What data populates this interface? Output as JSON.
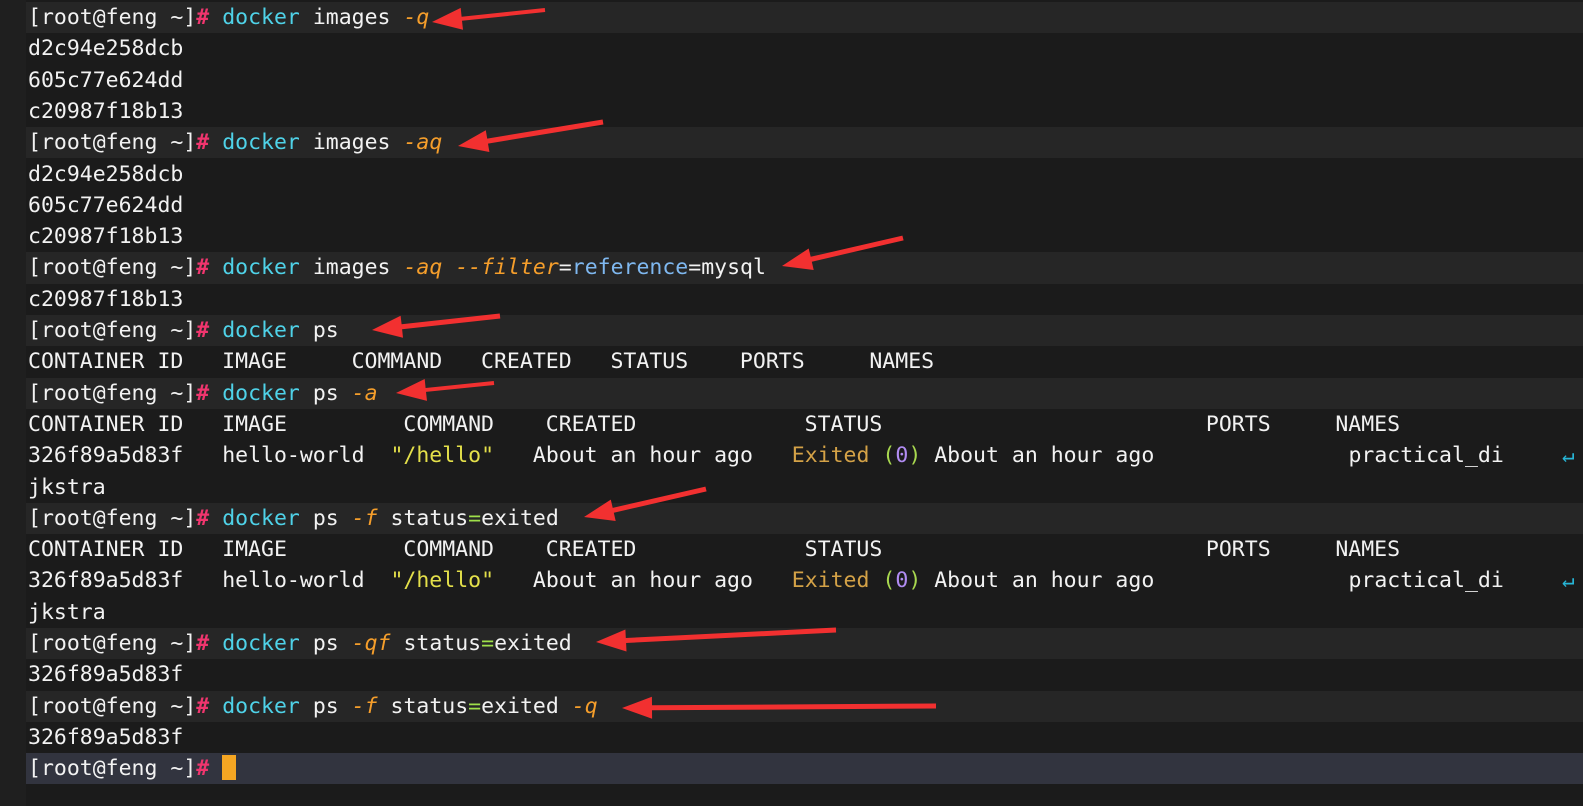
{
  "terminal": {
    "prompt": "[root@feng ~]#",
    "prompt_user": "[root@feng ~]",
    "prompt_sigil": "#",
    "colors": {
      "background": "#1b1b1b",
      "command_row_background": "#262626",
      "active_row_background": "#32343f",
      "gutter_background": "#1f1f1f",
      "foreground": "#e8e8e8",
      "command": "#4fd2e8",
      "flag": "#f59e2b",
      "equals": "#9fe04a",
      "key": "#7fb8f0",
      "string": "#e4e04a",
      "exited": "#d4a247",
      "paren": "#a8d84f",
      "number": "#b18cf2",
      "hash": "#f0356e",
      "cursor": "#f5a623",
      "wrap_indicator": "#27b5d6",
      "annotation_arrow": "#f23030"
    },
    "wrap_indicator_glyph": "↵",
    "rows": [
      {
        "kind": "command",
        "command": "docker",
        "args": "images",
        "flags": "-q",
        "arrow": true
      },
      {
        "kind": "output",
        "text": "d2c94e258dcb"
      },
      {
        "kind": "output",
        "text": "605c77e624dd"
      },
      {
        "kind": "output",
        "text": "c20987f18b13"
      },
      {
        "kind": "command",
        "command": "docker",
        "args": "images",
        "flags": "-aq",
        "arrow": true
      },
      {
        "kind": "output",
        "text": "d2c94e258dcb"
      },
      {
        "kind": "output",
        "text": "605c77e624dd"
      },
      {
        "kind": "output",
        "text": "c20987f18b13"
      },
      {
        "kind": "command",
        "command": "docker",
        "args": "images",
        "flags": "-aq",
        "filter": "--filter",
        "filter_key": "reference",
        "filter_value": "mysql",
        "arrow": true
      },
      {
        "kind": "output",
        "text": "c20987f18b13"
      },
      {
        "kind": "command",
        "command": "docker",
        "args": "ps",
        "flags": "",
        "arrow": true
      },
      {
        "kind": "table_header",
        "text": "CONTAINER ID   IMAGE     COMMAND   CREATED   STATUS    PORTS     NAMES"
      },
      {
        "kind": "command",
        "command": "docker",
        "args": "ps",
        "flags": "-a",
        "arrow": true
      },
      {
        "kind": "table_header",
        "text": "CONTAINER ID   IMAGE         COMMAND    CREATED             STATUS                         PORTS     NAMES"
      },
      {
        "kind": "container_row"
      },
      {
        "kind": "output",
        "text": "jkstra"
      },
      {
        "kind": "command",
        "command": "docker",
        "args": "ps",
        "flags": "-f",
        "filter_expr_key": "status",
        "filter_expr_value": "exited",
        "arrow": true
      },
      {
        "kind": "table_header",
        "text": "CONTAINER ID   IMAGE         COMMAND    CREATED             STATUS                         PORTS     NAMES"
      },
      {
        "kind": "container_row"
      },
      {
        "kind": "output",
        "text": "jkstra"
      },
      {
        "kind": "command",
        "command": "docker",
        "args": "ps",
        "flags": "-qf",
        "filter_expr_key": "status",
        "filter_expr_value": "exited",
        "arrow": true
      },
      {
        "kind": "output",
        "text": "326f89a5d83f"
      },
      {
        "kind": "command",
        "command": "docker",
        "args": "ps",
        "flags": "-f",
        "filter_expr_key": "status",
        "filter_expr_value": "exited",
        "flags_trailing": "-q",
        "arrow": true
      },
      {
        "kind": "output",
        "text": "326f89a5d83f"
      },
      {
        "kind": "active_prompt"
      }
    ],
    "container": {
      "id": "326f89a5d83f",
      "image": "hello-world",
      "command": "\"/hello\"",
      "created": "About an hour ago",
      "status_word": "Exited",
      "status_code": "0",
      "status_rest": "About an hour ago",
      "ports": "",
      "names": "practical_di"
    },
    "table_columns": [
      "CONTAINER ID",
      "IMAGE",
      "COMMAND",
      "CREATED",
      "STATUS",
      "PORTS",
      "NAMES"
    ]
  }
}
